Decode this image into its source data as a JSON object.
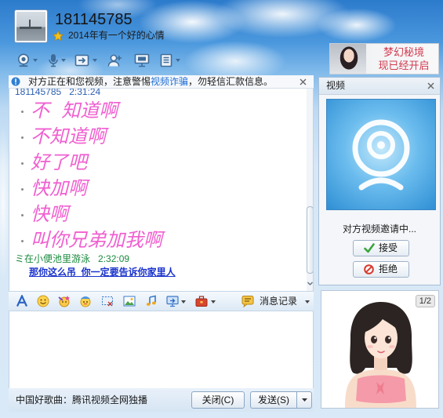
{
  "header": {
    "contact_name": "181145785",
    "signature": "2014年有一个好的心情",
    "toolbar_icons": [
      "video-call-icon",
      "voice-call-icon",
      "file-transfer-icon",
      "add-friend-icon",
      "remote-desktop-icon",
      "document-icon"
    ]
  },
  "ad": {
    "line1": "梦幻秘境",
    "line2": "现已经开启"
  },
  "warning": {
    "text_before": "对方正在和您视频，注意警惕",
    "link": "视频诈骗",
    "text_after": "，勿轻信汇款信息。"
  },
  "chat": {
    "partner_header": {
      "name": "181145785",
      "time": "2:31:24"
    },
    "partner_messages": [
      "不  知道啊",
      "不知道啊",
      "好了吧",
      "快加啊",
      "快啊",
      "叫你兄弟加我啊"
    ],
    "self_header": {
      "name": "ミ在小便池里游泳",
      "time": "2:32:09"
    },
    "self_messages": [
      "那你这么吊  你一定要告诉你家里人"
    ]
  },
  "format_toolbar": {
    "icons": [
      "font-icon",
      "emoji-icon",
      "magic-emoji-icon",
      "doodle-emoji-icon",
      "screenshot-icon",
      "image-icon",
      "music-icon",
      "screen-share-icon",
      "app-box-icon"
    ],
    "history_label": "消息记录"
  },
  "bottom_bar": {
    "promo": "中国好歌曲：腾讯视频全网独播",
    "close_label": "关闭(C)",
    "send_label": "发送(S)"
  },
  "video_panel": {
    "title": "视频",
    "status": "对方视频邀请中...",
    "accept_label": "接受",
    "reject_label": "拒绝"
  },
  "show_panel": {
    "page_indicator": "1/2"
  },
  "colors": {
    "partner_name": "#2d5fb3",
    "self_name": "#1a8a3e",
    "partner_message": "#f05fd0",
    "self_message": "#1a33cc",
    "warning_link": "#1f6fd6",
    "ad_text": "#d23b4e",
    "accept_icon": "#3aa53a",
    "reject_icon": "#d63a2e"
  }
}
